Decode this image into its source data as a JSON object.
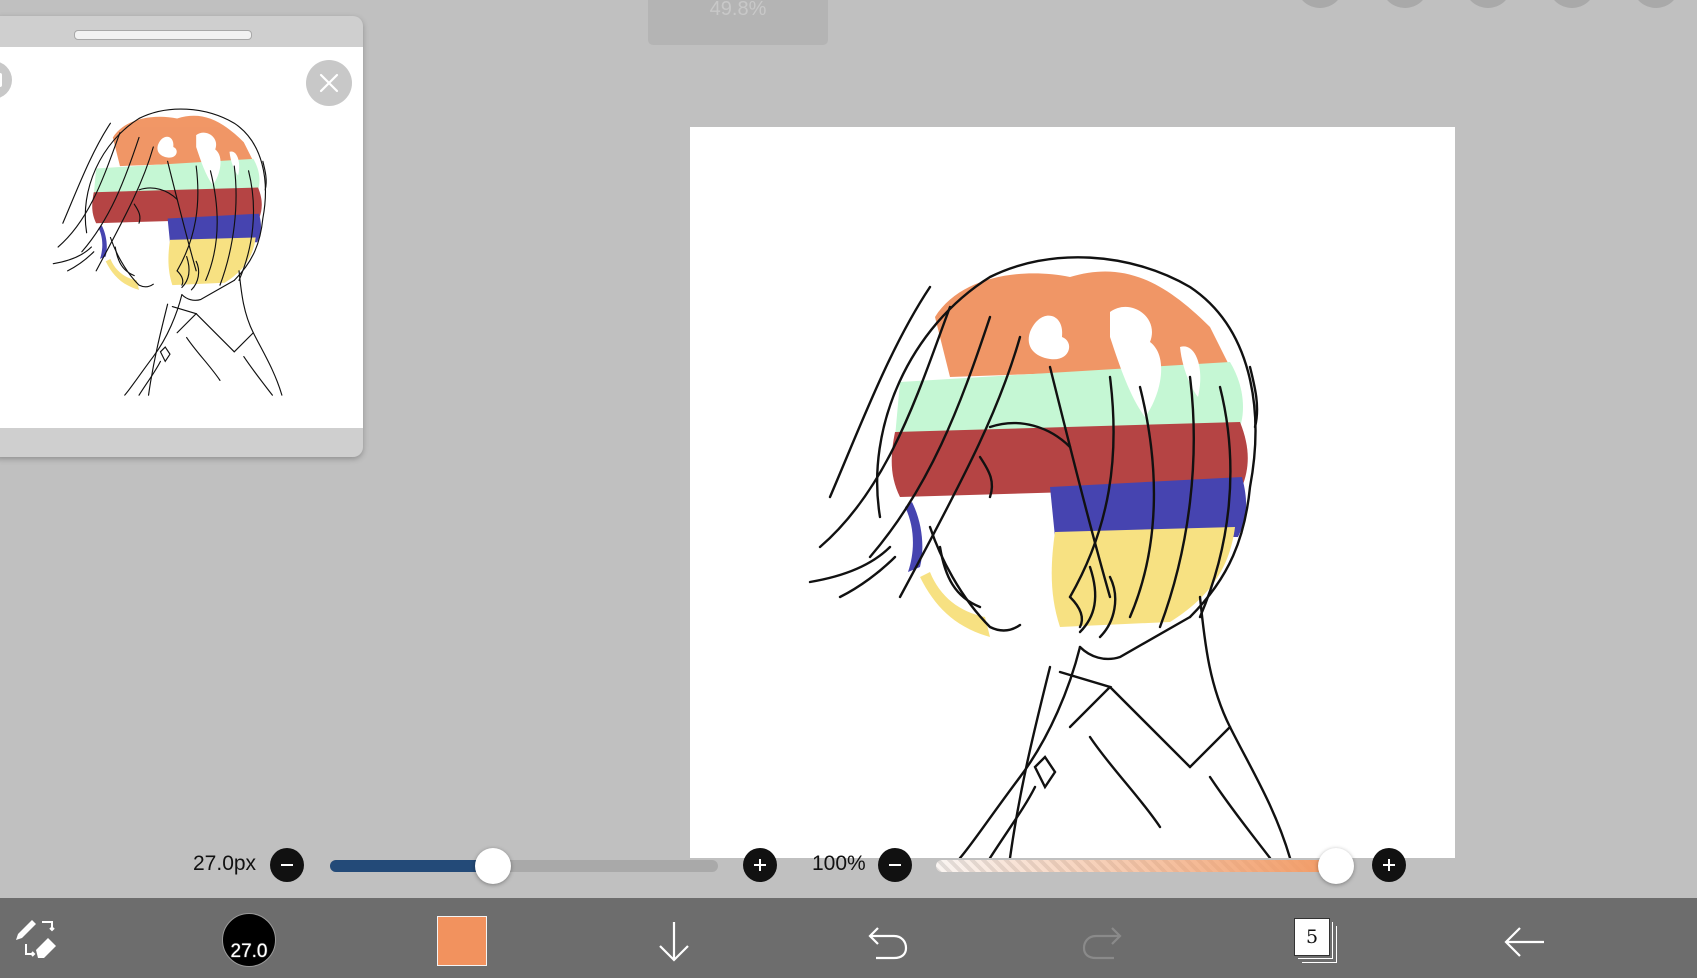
{
  "zoom_indicator": "49.8%",
  "reference_window": {
    "handle": "drag-handle",
    "close_icon": "close-icon",
    "side_icon": "reference-mode-icon"
  },
  "brush_size_slider": {
    "label": "27.0px",
    "value_fraction": 0.42,
    "minus_icon": "minus-icon",
    "plus_icon": "plus-icon",
    "fill_color": "#234a78"
  },
  "opacity_slider": {
    "label": "100%",
    "value_fraction": 1.0,
    "minus_icon": "minus-icon",
    "plus_icon": "plus-icon",
    "fill_color": "#f29a64"
  },
  "toolbar": {
    "tool_switch_icon": "pen-eraser-swap-icon",
    "brush_size_label": "27.0",
    "color_swatch": "#f2925e",
    "download_icon": "arrow-down-icon",
    "undo_icon": "undo-icon",
    "redo_icon": "redo-icon",
    "layers_count": "5",
    "back_icon": "back-arrow-icon"
  },
  "colors": {
    "background": "#c0c0c0",
    "toolbar": "#6d6d6d",
    "hair_orange": "#f0915e",
    "hair_mint": "#c2f7d2",
    "hair_red": "#b23a3a",
    "hair_blue": "#3d3aac",
    "hair_yellow": "#f7e07c"
  }
}
